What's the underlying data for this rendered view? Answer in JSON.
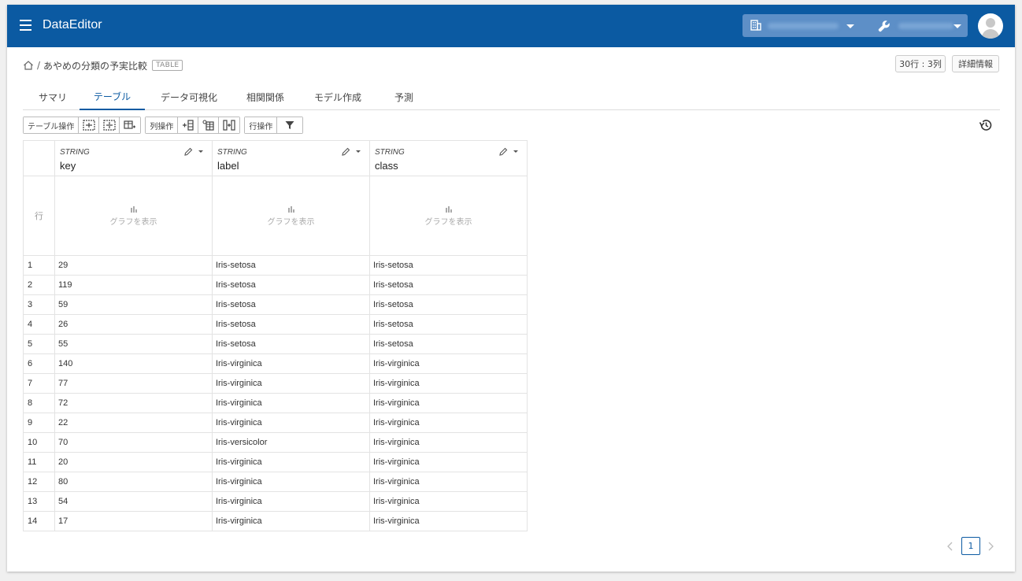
{
  "header": {
    "title": "DataEditor",
    "org_icon": "building-icon",
    "project_icon": "wrench-icon",
    "accent": "#0b5aa2"
  },
  "breadcrumb": {
    "sep": "/",
    "title": "あやめの分類の予実比較",
    "badge": "TABLE"
  },
  "top_buttons": {
    "rows_cols": "30行 : 3列",
    "details": "詳細情報"
  },
  "tabs": [
    {
      "label": "サマリ"
    },
    {
      "label": "テーブル",
      "active": true
    },
    {
      "label": "データ可視化"
    },
    {
      "label": "相関関係"
    },
    {
      "label": "モデル作成"
    },
    {
      "label": "予測"
    }
  ],
  "toolbar": {
    "table_ops": "テーブル操作",
    "col_ops": "列操作",
    "row_ops": "行操作"
  },
  "table": {
    "row_header": "行",
    "graph_label": "グラフを表示",
    "columns": [
      {
        "type": "STRING",
        "name": "key"
      },
      {
        "type": "STRING",
        "name": "label"
      },
      {
        "type": "STRING",
        "name": "class"
      }
    ],
    "rows": [
      {
        "n": "1",
        "key": "29",
        "label": "Iris-setosa",
        "class": "Iris-setosa"
      },
      {
        "n": "2",
        "key": "119",
        "label": "Iris-setosa",
        "class": "Iris-setosa"
      },
      {
        "n": "3",
        "key": "59",
        "label": "Iris-setosa",
        "class": "Iris-setosa"
      },
      {
        "n": "4",
        "key": "26",
        "label": "Iris-setosa",
        "class": "Iris-setosa"
      },
      {
        "n": "5",
        "key": "55",
        "label": "Iris-setosa",
        "class": "Iris-setosa"
      },
      {
        "n": "6",
        "key": "140",
        "label": "Iris-virginica",
        "class": "Iris-virginica"
      },
      {
        "n": "7",
        "key": "77",
        "label": "Iris-virginica",
        "class": "Iris-virginica"
      },
      {
        "n": "8",
        "key": "72",
        "label": "Iris-virginica",
        "class": "Iris-virginica"
      },
      {
        "n": "9",
        "key": "22",
        "label": "Iris-virginica",
        "class": "Iris-virginica"
      },
      {
        "n": "10",
        "key": "70",
        "label": "Iris-versicolor",
        "class": "Iris-virginica"
      },
      {
        "n": "11",
        "key": "20",
        "label": "Iris-virginica",
        "class": "Iris-virginica"
      },
      {
        "n": "12",
        "key": "80",
        "label": "Iris-virginica",
        "class": "Iris-virginica"
      },
      {
        "n": "13",
        "key": "54",
        "label": "Iris-virginica",
        "class": "Iris-virginica"
      },
      {
        "n": "14",
        "key": "17",
        "label": "Iris-virginica",
        "class": "Iris-virginica"
      }
    ]
  },
  "pagination": {
    "current": "1"
  }
}
